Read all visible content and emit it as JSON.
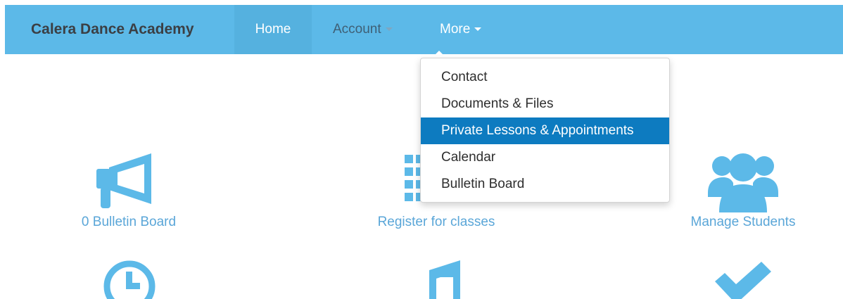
{
  "navbar": {
    "brand": "Calera Dance Academy",
    "items": [
      {
        "label": "Home"
      },
      {
        "label": "Account"
      },
      {
        "label": "More"
      }
    ]
  },
  "dropdown": {
    "items": [
      {
        "label": "Contact"
      },
      {
        "label": "Documents & Files"
      },
      {
        "label": "Private Lessons & Appointments"
      },
      {
        "label": "Calendar"
      },
      {
        "label": "Bulletin Board"
      }
    ],
    "active_index": 2
  },
  "tiles": [
    {
      "label": "0 Bulletin Board",
      "icon": "megaphone-icon"
    },
    {
      "label": "Register for classes",
      "icon": "grid-list-icon"
    },
    {
      "label": "Manage Students",
      "icon": "users-icon"
    },
    {
      "label": "",
      "icon": "clock-icon"
    },
    {
      "label": "",
      "icon": "music-note-icon"
    },
    {
      "label": "",
      "icon": "checkmark-icon"
    }
  ],
  "colors": {
    "navbar": "#5cb9e8",
    "accent": "#5aa6d8",
    "active": "#0d7bc0"
  }
}
